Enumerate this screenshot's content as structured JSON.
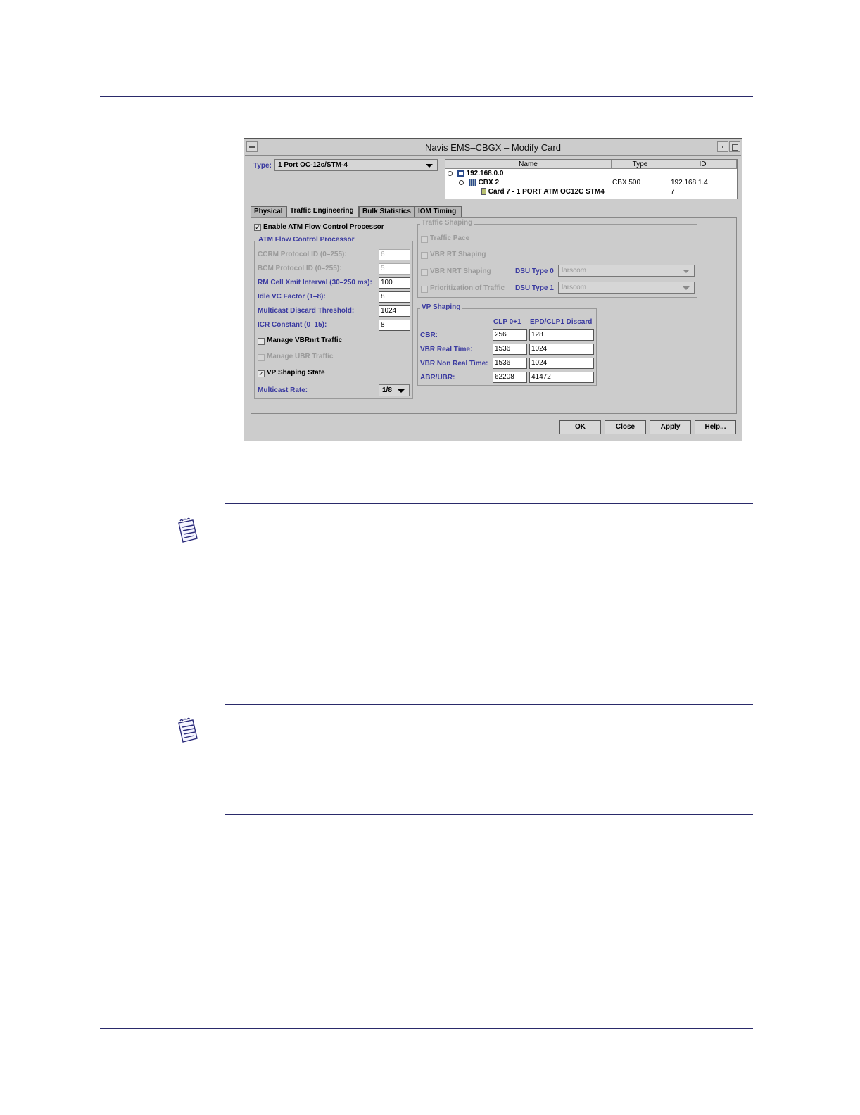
{
  "window": {
    "title": "Navis EMS–CBGX – Modify Card"
  },
  "type_field": {
    "label": "Type:",
    "value": "1 Port OC-12c/STM-4"
  },
  "tree": {
    "columns": [
      "Name",
      "Type",
      "ID"
    ],
    "rows": [
      {
        "name": "192.168.0.0",
        "type": "",
        "id": ""
      },
      {
        "name": "CBX 2",
        "type": "CBX 500",
        "id": "192.168.1.4"
      },
      {
        "name": "Card 7 - 1 PORT ATM OC12C STM4",
        "type": "",
        "id": "7"
      }
    ]
  },
  "tabs": [
    "Physical",
    "Traffic Engineering",
    "Bulk Statistics",
    "IOM Timing"
  ],
  "afcp": {
    "enable_label": "Enable ATM Flow Control Processor",
    "group_title": "ATM Flow Control Processor",
    "fields": [
      {
        "label": "CCRM Protocol ID (0–255):",
        "value": "6"
      },
      {
        "label": "BCM Protocol ID (0–255):",
        "value": "5"
      },
      {
        "label": "RM Cell Xmit Interval (30–250 ms):",
        "value": "100"
      },
      {
        "label": "Idle VC Factor (1–8):",
        "value": "8"
      },
      {
        "label": "Multicast Discard Threshold:",
        "value": "1024"
      },
      {
        "label": "ICR Constant (0–15):",
        "value": "8"
      }
    ],
    "manage_vbrnrt": "Manage VBRnrt Traffic",
    "manage_ubr": "Manage UBR Traffic",
    "vp_shaping_state": "VP Shaping State",
    "multicast_rate_label": "Multicast Rate:",
    "multicast_rate_value": "1/8"
  },
  "traffic_shaping": {
    "group_title": "Traffic Shaping",
    "traffic_pace": "Traffic Pace",
    "vbr_rt": "VBR RT Shaping",
    "vbr_nrt": "VBR NRT Shaping",
    "prioritization": "Prioritization of Traffic",
    "dsu0_label": "DSU Type 0",
    "dsu0_value": "larscom",
    "dsu1_label": "DSU Type 1",
    "dsu1_value": "larscom"
  },
  "vp_shaping": {
    "group_title": "VP Shaping",
    "col1": "CLP 0+1",
    "col2": "EPD/CLP1 Discard",
    "rows": [
      {
        "label": "CBR:",
        "v1": "256",
        "v2": "128"
      },
      {
        "label": "VBR Real Time:",
        "v1": "1536",
        "v2": "1024"
      },
      {
        "label": "VBR Non Real Time:",
        "v1": "1536",
        "v2": "1024"
      },
      {
        "label": "ABR/UBR:",
        "v1": "62208",
        "v2": "41472"
      }
    ]
  },
  "buttons": {
    "ok": "OK",
    "close": "Close",
    "apply": "Apply",
    "help": "Help..."
  }
}
